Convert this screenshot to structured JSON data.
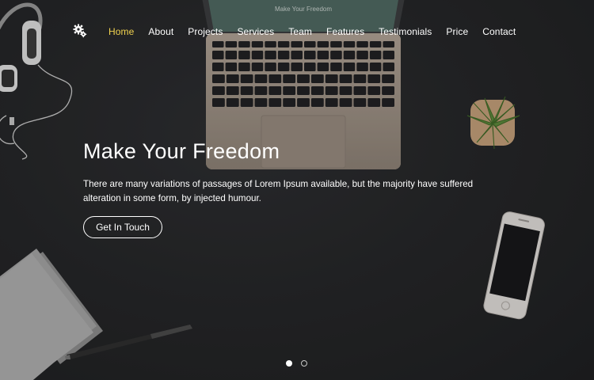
{
  "nav": {
    "logo_icon": "gears-icon",
    "items": [
      {
        "label": "Home",
        "active": true
      },
      {
        "label": "About"
      },
      {
        "label": "Projects"
      },
      {
        "label": "Services"
      },
      {
        "label": "Team"
      },
      {
        "label": "Features"
      },
      {
        "label": "Testimonials"
      },
      {
        "label": "Price"
      },
      {
        "label": "Contact"
      }
    ]
  },
  "hero": {
    "title": "Make Your Freedom",
    "description": "There are many variations of passages of Lorem Ipsum available, but the majority have suffered alteration in some form, by injected humour.",
    "cta_label": "Get In Touch",
    "laptop_screen_text": "Make Your Freedom"
  },
  "slider": {
    "total": 2,
    "active_index": 0
  },
  "colors": {
    "active_nav": "#f2d34f",
    "background": "#1f2022",
    "text": "#ffffff"
  }
}
